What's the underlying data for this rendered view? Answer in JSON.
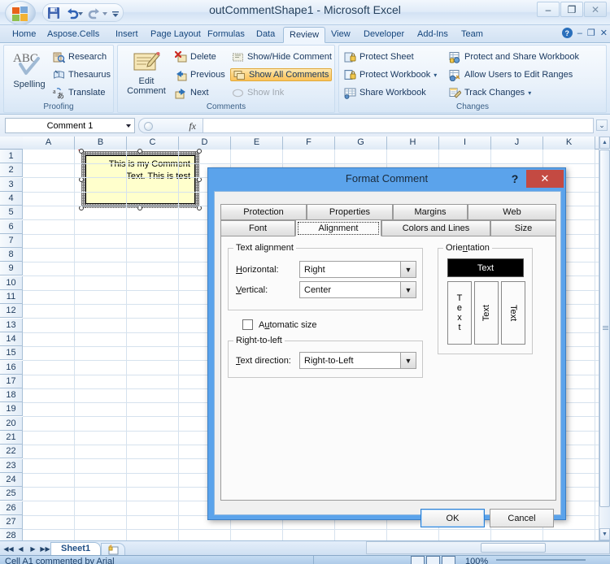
{
  "window": {
    "title": "outCommentShape1 - Microsoft Excel",
    "minimize": "–",
    "maximize": "❐",
    "close": "✕"
  },
  "quick_access": {
    "save": "save-icon",
    "undo": "undo-icon",
    "redo": "redo-icon",
    "more": "⌄"
  },
  "ribbon": {
    "tabs": [
      {
        "label": "Home",
        "active": false
      },
      {
        "label": "Aspose.Cells",
        "active": false
      },
      {
        "label": "Insert",
        "active": false
      },
      {
        "label": "Page Layout",
        "active": false
      },
      {
        "label": "Formulas",
        "active": false
      },
      {
        "label": "Data",
        "active": false
      },
      {
        "label": "Review",
        "active": true
      },
      {
        "label": "View",
        "active": false
      },
      {
        "label": "Developer",
        "active": false
      },
      {
        "label": "Add-Ins",
        "active": false
      },
      {
        "label": "Team",
        "active": false
      }
    ],
    "help_icon": "?",
    "ribbon_minimize": "–",
    "ribbon_restore": "❐",
    "ribbon_close": "✕",
    "groups": [
      {
        "name": "Proofing",
        "big": {
          "label_line1": "",
          "label_line2": "Spelling",
          "icon": "abc-check-icon"
        },
        "items": [
          {
            "label": "Research",
            "icon": "research-icon",
            "state": "normal"
          },
          {
            "label": "Thesaurus",
            "icon": "thesaurus-icon",
            "state": "normal"
          },
          {
            "label": "Translate",
            "icon": "translate-icon",
            "state": "normal"
          }
        ]
      },
      {
        "name": "Comments",
        "big": {
          "label_line1": "Edit",
          "label_line2": "Comment",
          "icon": "edit-comment-icon"
        },
        "items": [
          {
            "label": "Delete",
            "icon": "delete-comment-icon",
            "state": "normal"
          },
          {
            "label": "Previous",
            "icon": "previous-comment-icon",
            "state": "normal"
          },
          {
            "label": "Next",
            "icon": "next-comment-icon",
            "state": "normal"
          },
          {
            "label": "Show/Hide Comment",
            "icon": "show-hide-comment-icon",
            "state": "normal"
          },
          {
            "label": "Show All Comments",
            "icon": "show-all-comments-icon",
            "state": "toggled"
          },
          {
            "label": "Show Ink",
            "icon": "show-ink-icon",
            "state": "disabled"
          }
        ]
      },
      {
        "name": "Changes",
        "items": [
          {
            "label": "Protect Sheet",
            "icon": "protect-sheet-icon",
            "state": "normal"
          },
          {
            "label": "Protect Workbook",
            "icon": "protect-workbook-icon",
            "state": "normal",
            "dropdown": "▾"
          },
          {
            "label": "Share Workbook",
            "icon": "share-workbook-icon",
            "state": "normal"
          },
          {
            "label": "Protect and Share Workbook",
            "icon": "protect-share-workbook-icon",
            "state": "normal"
          },
          {
            "label": "Allow Users to Edit Ranges",
            "icon": "allow-users-edit-ranges-icon",
            "state": "normal"
          },
          {
            "label": "Track Changes",
            "icon": "track-changes-icon",
            "state": "normal",
            "dropdown": "▾"
          }
        ]
      }
    ]
  },
  "formula_bar": {
    "name_box_value": "Comment 1",
    "fx_label": "fx",
    "formula_value": "",
    "formula_placeholder": "",
    "expand_icon": "⌄"
  },
  "grid": {
    "columns": [
      "A",
      "B",
      "C",
      "D",
      "E",
      "F",
      "G",
      "H",
      "I",
      "J",
      "K"
    ],
    "rows": [
      1,
      2,
      3,
      4,
      5,
      6,
      7,
      8,
      9,
      10,
      11,
      12,
      13,
      14,
      15,
      16,
      17,
      18,
      19,
      20,
      21,
      22,
      23,
      24,
      25,
      26,
      27,
      28
    ],
    "comment": {
      "text": "This is my Comment Text. This is test",
      "fill_color": "#ffffcc",
      "border_color": "#000000"
    }
  },
  "sheet_tabs": {
    "nav_first": "◀◀",
    "nav_prev": "◀",
    "nav_next": "▶",
    "nav_last": "▶▶",
    "tabs": [
      {
        "label": "Sheet1",
        "active": true
      }
    ],
    "insert_sheet_icon": "insert-worksheet-icon"
  },
  "status_bar": {
    "text": "Cell A1 commented by Arial",
    "view_normal": "normal-view-icon",
    "view_layout": "page-layout-view-icon",
    "view_break": "page-break-view-icon",
    "zoom": "100%"
  },
  "dialog": {
    "title": "Format Comment",
    "help_button": "?",
    "close_button": "✕",
    "tabs_row1": [
      {
        "label": "Protection",
        "selected": false
      },
      {
        "label": "Properties",
        "selected": false
      },
      {
        "label": "Margins",
        "selected": false
      },
      {
        "label": "Web",
        "selected": false
      }
    ],
    "tabs_row2": [
      {
        "label": "Font",
        "selected": false
      },
      {
        "label": "Alignment",
        "selected": true
      },
      {
        "label": "Colors and Lines",
        "selected": false
      },
      {
        "label": "Size",
        "selected": false
      }
    ],
    "text_alignment": {
      "group_label": "Text alignment",
      "horizontal_label": "Horizontal:",
      "horizontal_value": "Right",
      "vertical_label": "Vertical:",
      "vertical_value": "Center",
      "automatic_size_label": "Automatic size",
      "automatic_size_checked": false
    },
    "right_to_left": {
      "group_label": "Right-to-left",
      "text_direction_label": "Text direction:",
      "text_direction_value": "Right-to-Left"
    },
    "orientation": {
      "group_label": "Orientation",
      "selected_sample": "Text",
      "stacked_sample": "Text",
      "rotate_up_sample": "Text",
      "rotate_down_sample": "Text"
    },
    "buttons": {
      "ok": "OK",
      "cancel": "Cancel"
    }
  }
}
